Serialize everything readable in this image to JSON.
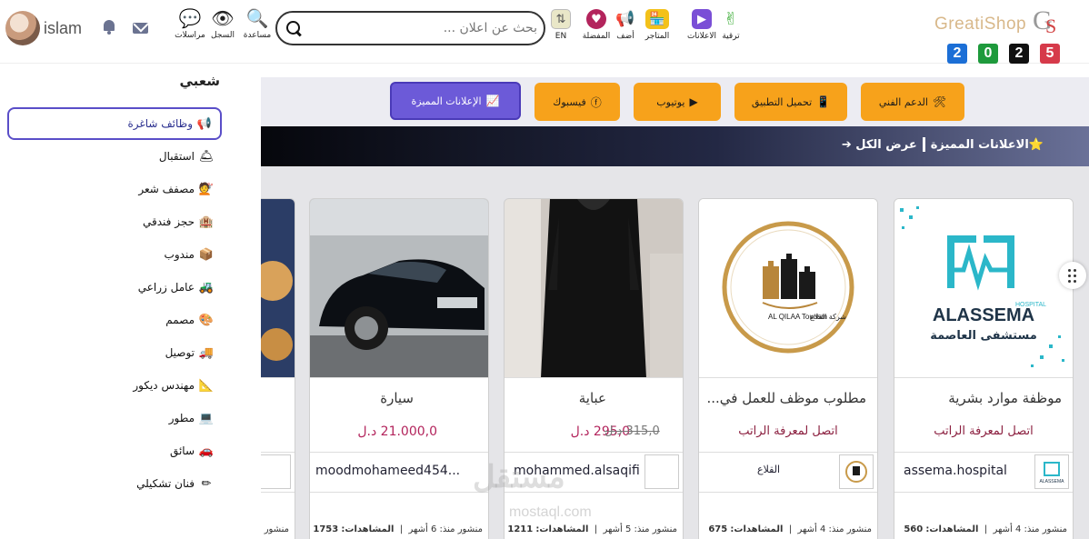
{
  "header": {
    "username": "islam",
    "quick_links": [
      {
        "label": "مراسلات",
        "icon": "chat-bubbles-icon",
        "glyph": "💬"
      },
      {
        "label": "السجل",
        "icon": "eye-icon",
        "glyph": "👁"
      },
      {
        "label": "مساعدة",
        "icon": "magnifier-help-icon",
        "glyph": "🔍"
      }
    ],
    "search": {
      "placeholder": "بحث عن اعلان ..."
    },
    "nav": [
      {
        "label": "EN",
        "icon": "language-icon",
        "glyph": "⇅",
        "color": "#e9e7c8"
      },
      {
        "label": "المفضلة",
        "icon": "heart-icon",
        "glyph": "♥",
        "color": "#b3245c"
      },
      {
        "label": "أضف",
        "icon": "megaphone-icon",
        "glyph": "📢",
        "color": "#ffffff"
      },
      {
        "label": "المتاجر",
        "icon": "store-icon",
        "glyph": "🏪",
        "color": "#f3c11a"
      },
      {
        "label": "الاعلانات",
        "icon": "video-ads-icon",
        "glyph": "▶",
        "color": "#7a4fd6"
      },
      {
        "label": "ترقية",
        "icon": "victory-hand-icon",
        "glyph": "✌",
        "color": "#ffffff"
      }
    ],
    "logo_text": "GreatiShop",
    "year_digits": [
      {
        "d": "2",
        "color": "#1c6fd6"
      },
      {
        "d": "0",
        "color": "#1e9a3c"
      },
      {
        "d": "2",
        "color": "#111111"
      },
      {
        "d": "5",
        "color": "#d63a4a"
      }
    ]
  },
  "sidebar": {
    "title": "شعبي",
    "items": [
      {
        "label": "وظائف شاغرة",
        "icon": "megaphone-icon",
        "glyph": "📢",
        "active": true
      },
      {
        "label": "استقبال",
        "icon": "reception-bell-icon",
        "glyph": "🛎"
      },
      {
        "label": "مصفف شعر",
        "icon": "hairdresser-icon",
        "glyph": "💇"
      },
      {
        "label": "حجز فندقي",
        "icon": "hotel-icon",
        "glyph": "🏨"
      },
      {
        "label": "مندوب",
        "icon": "package-icon",
        "glyph": "📦"
      },
      {
        "label": "عامل زراعي",
        "icon": "tractor-icon",
        "glyph": "🚜"
      },
      {
        "label": "مصمم",
        "icon": "palette-icon",
        "glyph": "🎨"
      },
      {
        "label": "توصيل",
        "icon": "delivery-truck-icon",
        "glyph": "🚚"
      },
      {
        "label": "مهندس ديكور",
        "icon": "triangle-ruler-icon",
        "glyph": "📐"
      },
      {
        "label": "مطور",
        "icon": "laptop-icon",
        "glyph": "💻"
      },
      {
        "label": "سائق",
        "icon": "car-icon",
        "glyph": "🚗"
      },
      {
        "label": "فنان تشكيلي",
        "icon": "pencil-icon",
        "glyph": "✏"
      }
    ]
  },
  "tabs": [
    {
      "label": "الدعم الفني",
      "icon": "tools-icon",
      "glyph": "🛠"
    },
    {
      "label": "تحميل التطبيق",
      "icon": "mobile-icon",
      "glyph": "📱"
    },
    {
      "label": "يوتيوب",
      "icon": "youtube-icon",
      "glyph": "▶"
    },
    {
      "label": "فيسبوك",
      "icon": "facebook-icon",
      "glyph": "ⓕ"
    },
    {
      "label": "الإعلانات المميزة",
      "icon": "chart-icon",
      "glyph": "📈"
    }
  ],
  "banner": {
    "title": "⭐الاعلانات المميزة",
    "view_all": "عرض الكل"
  },
  "cards": [
    {
      "title": "موظفة موارد بشرية",
      "sub": "اتصل لمعرفة الراتب",
      "user": "assema.hospital",
      "posted": "منشور منذ: 4 أشهر",
      "views_label": "المشاهدات:",
      "views": "560"
    },
    {
      "title": "مطلوب موظف للعمل في...",
      "sub": "اتصل لمعرفة الراتب",
      "user": "القلاع",
      "posted": "منشور منذ: 4 أشهر",
      "views_label": "المشاهدات:",
      "views": "675"
    },
    {
      "title": "عباية",
      "price": "295,0 د.ل",
      "old_price": "315,0 د.ل",
      "user": "mohammed.alsaqifi",
      "posted": "منشور منذ: 5 أشهر",
      "views_label": "المشاهدات:",
      "views": "1211"
    },
    {
      "title": "سيارة",
      "price": "21.000,0 د.ل",
      "user": "moodmohameed454...",
      "posted": "منشور منذ: 6 أشهر",
      "views_label": "المشاهدات:",
      "views": "1753"
    },
    {
      "title": "",
      "posted": "منشور"
    }
  ],
  "logos": {
    "hospital_brand": "ALASSEMA",
    "hospital_word": "HOSPITAL",
    "hospital_ar": "مستشفى العاصمة",
    "qilaa_en": "AL QILAA Tourism",
    "qilaa_ar": "شركة القلاع"
  },
  "watermark": {
    "main": "مستقل",
    "sub": "mostaql.com"
  }
}
